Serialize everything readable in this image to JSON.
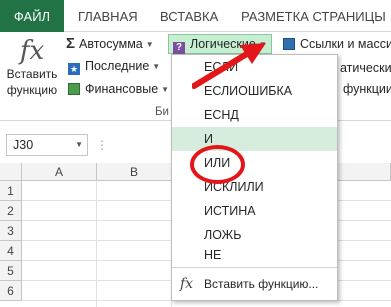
{
  "tabs": {
    "file": "ФАЙЛ",
    "home": "ГЛАВНАЯ",
    "insert": "ВСТАВКА",
    "layout": "РАЗМЕТКА СТРАНИЦЫ"
  },
  "ribbon": {
    "insert_function": "Вставить функцию",
    "insert_function_line1": "Вставить",
    "insert_function_line2": "функцию",
    "fx_symbol": "fx",
    "autosum": "Автосумма",
    "recent": "Последние",
    "financial": "Финансовые",
    "logical": "Логические",
    "lookup": "Ссылки и масси",
    "partial_right": "атические",
    "partial_right2": "функции",
    "group_label": "Би"
  },
  "formula_bar": {
    "name_box": "J30"
  },
  "grid": {
    "columns": [
      "A",
      "B"
    ],
    "rows": [
      "1",
      "2",
      "3",
      "4",
      "5",
      "6"
    ]
  },
  "menu": {
    "items": [
      "ЕСЛИ",
      "ЕСЛИОШИБКА",
      "ЕСНД",
      "И",
      "ИЛИ",
      "ИСКЛИЛИ",
      "ИСТИНА",
      "ЛОЖЬ",
      "НЕ"
    ],
    "highlighted": "И",
    "footer": "Вставить функцию...",
    "footer_icon": "fx"
  },
  "colors": {
    "file_tab": "#217346",
    "highlight": "#d6ecdc",
    "annotation": "#e3171a"
  }
}
